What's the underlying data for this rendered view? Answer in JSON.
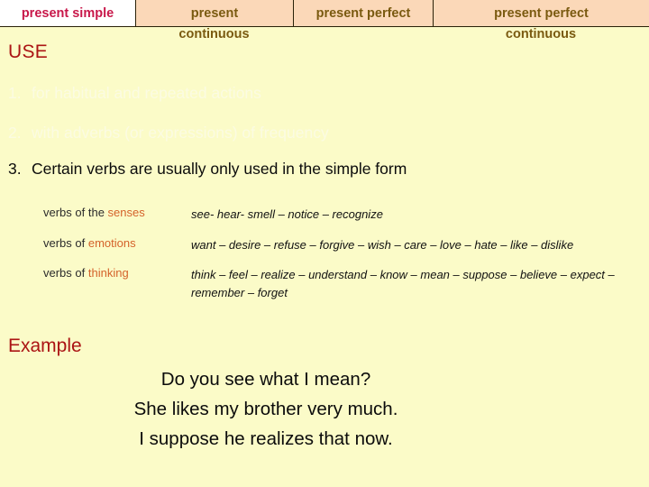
{
  "tabs": [
    {
      "label": "present simple",
      "sub": "",
      "active": true
    },
    {
      "label": "present",
      "sub": "continuous",
      "active": false
    },
    {
      "label": "present perfect",
      "sub": "",
      "active": false
    },
    {
      "label": "present perfect",
      "sub": "continuous",
      "active": false
    }
  ],
  "sections": {
    "use_heading": "USE",
    "example_heading": "Example"
  },
  "use_items": [
    {
      "num": "1.",
      "text": "for habitual and repeated actions",
      "state": "dimmed"
    },
    {
      "num": "2.",
      "text": "with adverbs (or expressions) of frequency",
      "state": "dimmed"
    },
    {
      "num": "3.",
      "text": "Certain verbs are usually only used in the simple form",
      "state": "shown"
    }
  ],
  "verb_table": [
    {
      "label_prefix": "verbs of the ",
      "label_accent": "senses",
      "examples": "see- hear- smell – notice – recognize"
    },
    {
      "label_prefix": "verbs of ",
      "label_accent": "emotions",
      "examples": "want – desire – refuse – forgive – wish – care – love – hate – like – dislike"
    },
    {
      "label_prefix": "verbs of ",
      "label_accent": "thinking",
      "examples": "think – feel – realize – understand – know – mean – suppose – believe – expect – remember – forget"
    }
  ],
  "example_lines": [
    "Do you see what I mean?",
    "She likes my brother  very much.",
    "I suppose he realizes that now."
  ],
  "colors": {
    "page_background": "#FBFBC8",
    "tab_inactive_background": "#FBD8B8",
    "tab_active_background": "#FFFFFF",
    "tab_active_text": "#C8184A",
    "tab_inactive_text": "#7A5A10",
    "heading_red": "#AB1414",
    "accent_orange": "#D4622A",
    "dimmed_text": "#FBFBE2",
    "body_text": "#0B0B0B"
  }
}
